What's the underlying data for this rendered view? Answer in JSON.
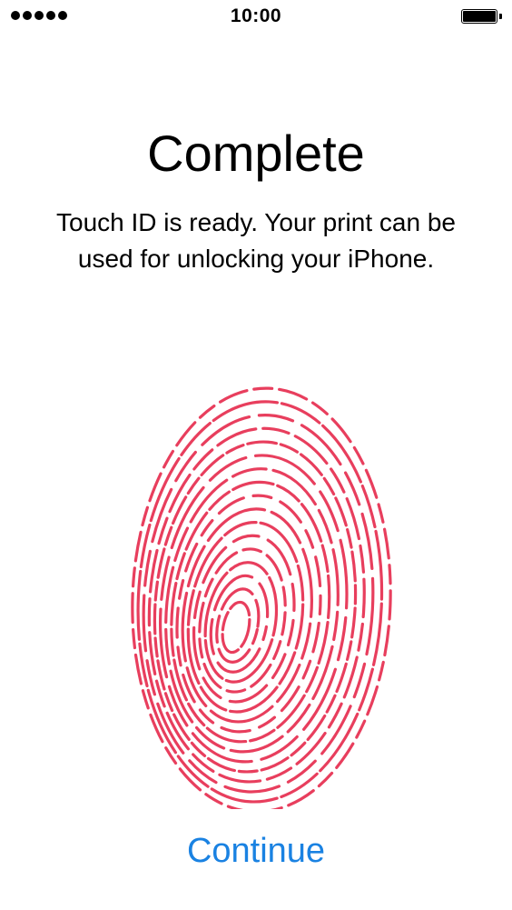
{
  "status_bar": {
    "time": "10:00",
    "signal_icon": "signal-dots-icon",
    "battery_icon": "battery-full-icon"
  },
  "title": "Complete",
  "message": "Touch ID is ready. Your print can be used for unlocking your iPhone.",
  "fingerprint": {
    "icon": "fingerprint-icon",
    "color": "#e83e5d"
  },
  "continue_label": "Continue",
  "accent_color": "#1a82e2"
}
